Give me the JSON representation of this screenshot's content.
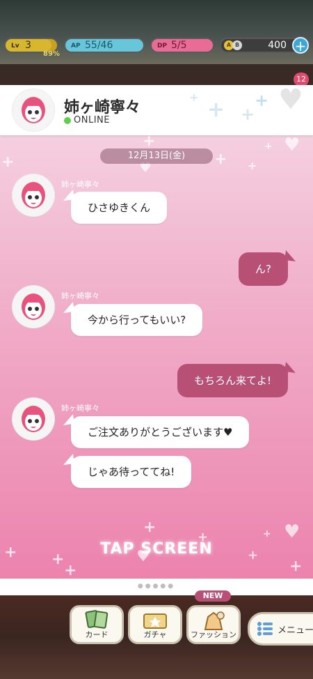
{
  "status_bar": {
    "level": {
      "tag": "Lv",
      "value": "3",
      "percent": "89%",
      "progress": 0.89
    },
    "ap": {
      "tag": "AP",
      "value": "55/46"
    },
    "dp": {
      "tag": "DP",
      "value": "5/5"
    },
    "coins": {
      "value": "400",
      "badge_a": "A",
      "badge_b": "B"
    },
    "notification_count": "12"
  },
  "chat": {
    "contact_name": "姉ヶ崎寧々",
    "status": "ONLINE",
    "date": "12月13日(金)",
    "messages": [
      {
        "sender": "姉ヶ崎寧々",
        "text": "ひさゆきくん"
      },
      {
        "sender": "me",
        "text": "ん?"
      },
      {
        "sender": "姉ヶ崎寧々",
        "text": "今から行ってもいい?"
      },
      {
        "sender": "me",
        "text": "もちろん来てよ!"
      },
      {
        "sender": "姉ヶ崎寧々",
        "text": "ご注文ありがとうございます♥"
      },
      {
        "sender": "姉ヶ崎寧々",
        "text": "じゃあ待っててね!"
      }
    ],
    "tap_prompt": "TAP SCREEN",
    "page_dots": "●●●●●"
  },
  "nav": {
    "card_label": "カード",
    "gacha_label": "ガチャ",
    "fashion_label": "ファッション",
    "fashion_badge": "NEW",
    "menu_label": "メニュー"
  },
  "colors": {
    "accent": "#b84f74",
    "online": "#5fcf4b",
    "panel_top": "#f6dae6",
    "panel_bottom": "#ec83ae"
  }
}
